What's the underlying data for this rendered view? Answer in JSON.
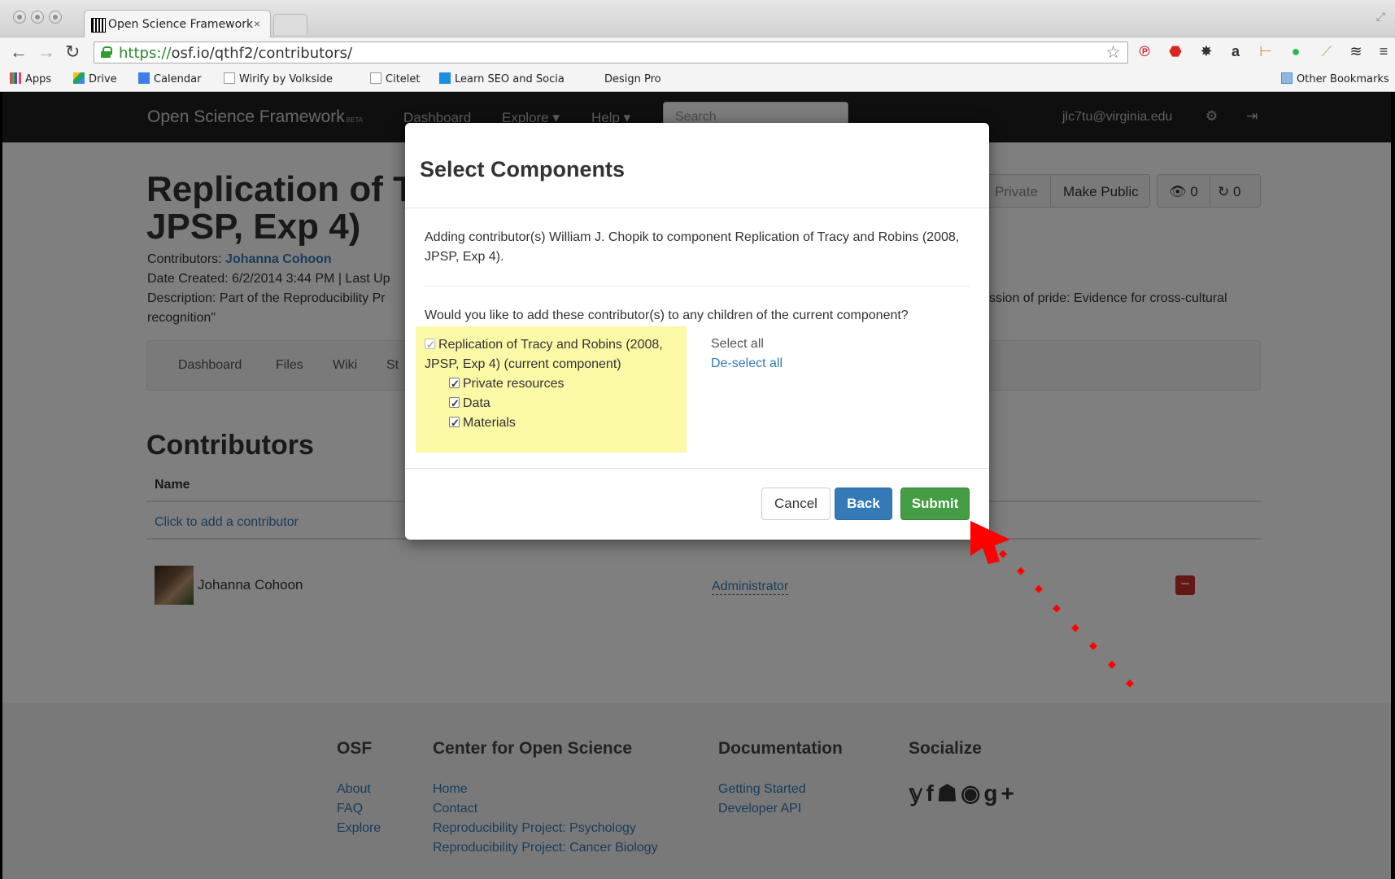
{
  "browser": {
    "tab_title": "Open Science Framework",
    "tab_close": "×",
    "url_scheme": "https://",
    "url_rest": "osf.io/qthf2/contributors/",
    "bookmarks": [
      "Apps",
      "Drive",
      "Calendar",
      "Wirify by Volkside",
      "Citelet",
      "Learn SEO and Socia",
      "Design Pro"
    ],
    "other_bookmarks": "Other Bookmarks"
  },
  "osf_nav": {
    "brand": "Open Science Framework",
    "brand_badge": "BETA",
    "items": [
      "Dashboard",
      "Explore ▾",
      "Help ▾"
    ],
    "search_placeholder": "Search",
    "user": "jlc7tu@virginia.edu"
  },
  "project": {
    "title": "Replication of Tracy and Robins (2008, JPSP, Exp 4)",
    "title_visible": "Replication of T",
    "title_line2": "JPSP, Exp 4)",
    "contributors_label": "Contributors:",
    "contributor_link": "Johanna Cohoon",
    "date_created": "Date Created: 6/2/2014 3:44 PM | Last Up",
    "description": "Description: Part of the Reproducibility Pr",
    "description_end": "ssion of pride: Evidence for cross-cultural",
    "description_line2": "recognition\"",
    "privacy": "Private",
    "make_public": "Make Public",
    "watch_count": "0",
    "fork_count": "0",
    "subnav": [
      "Dashboard",
      "Files",
      "Wiki",
      "St"
    ]
  },
  "contributors": {
    "heading": "Contributors",
    "col_name": "Name",
    "add_link": "Click to add a contributor",
    "rows": [
      {
        "name": "Johanna Cohoon",
        "permission": "Administrator",
        "remove": "−"
      }
    ]
  },
  "footer": {
    "cols": [
      {
        "title": "OSF",
        "links": [
          "About",
          "FAQ",
          "Explore"
        ]
      },
      {
        "title": "Center for Open Science",
        "links": [
          "Home",
          "Contact",
          "Reproducibility Project: Psychology",
          "Reproducibility Project: Cancer Biology"
        ]
      },
      {
        "title": "Documentation",
        "links": [
          "Getting Started",
          "Developer API"
        ]
      },
      {
        "title": "Socialize",
        "links": []
      }
    ],
    "social_icons": [
      "twitter-icon",
      "facebook-icon",
      "group-icon",
      "github-icon",
      "google-plus-icon"
    ]
  },
  "modal": {
    "title": "Select Components",
    "intro": "Adding contributor(s) William J. Chopik to component Replication of Tracy and Robins (2008, JPSP, Exp 4).",
    "question": "Would you like to add these contributor(s) to any children of the current component?",
    "components": [
      {
        "label": "Replication of Tracy and Robins (2008,",
        "label2": "JPSP, Exp 4) (current component)",
        "checked": true,
        "disabled": true
      },
      {
        "label": "Private resources",
        "checked": true
      },
      {
        "label": "Data",
        "checked": true
      },
      {
        "label": "Materials",
        "checked": true
      }
    ],
    "select_all": "Select all",
    "deselect_all": "De-select all",
    "cancel": "Cancel",
    "back": "Back",
    "submit": "Submit"
  },
  "colors": {
    "highlight": "#fbf8a6",
    "submit": "#449d44",
    "back": "#337ab7",
    "annotation_arrow": "#ff0000"
  }
}
